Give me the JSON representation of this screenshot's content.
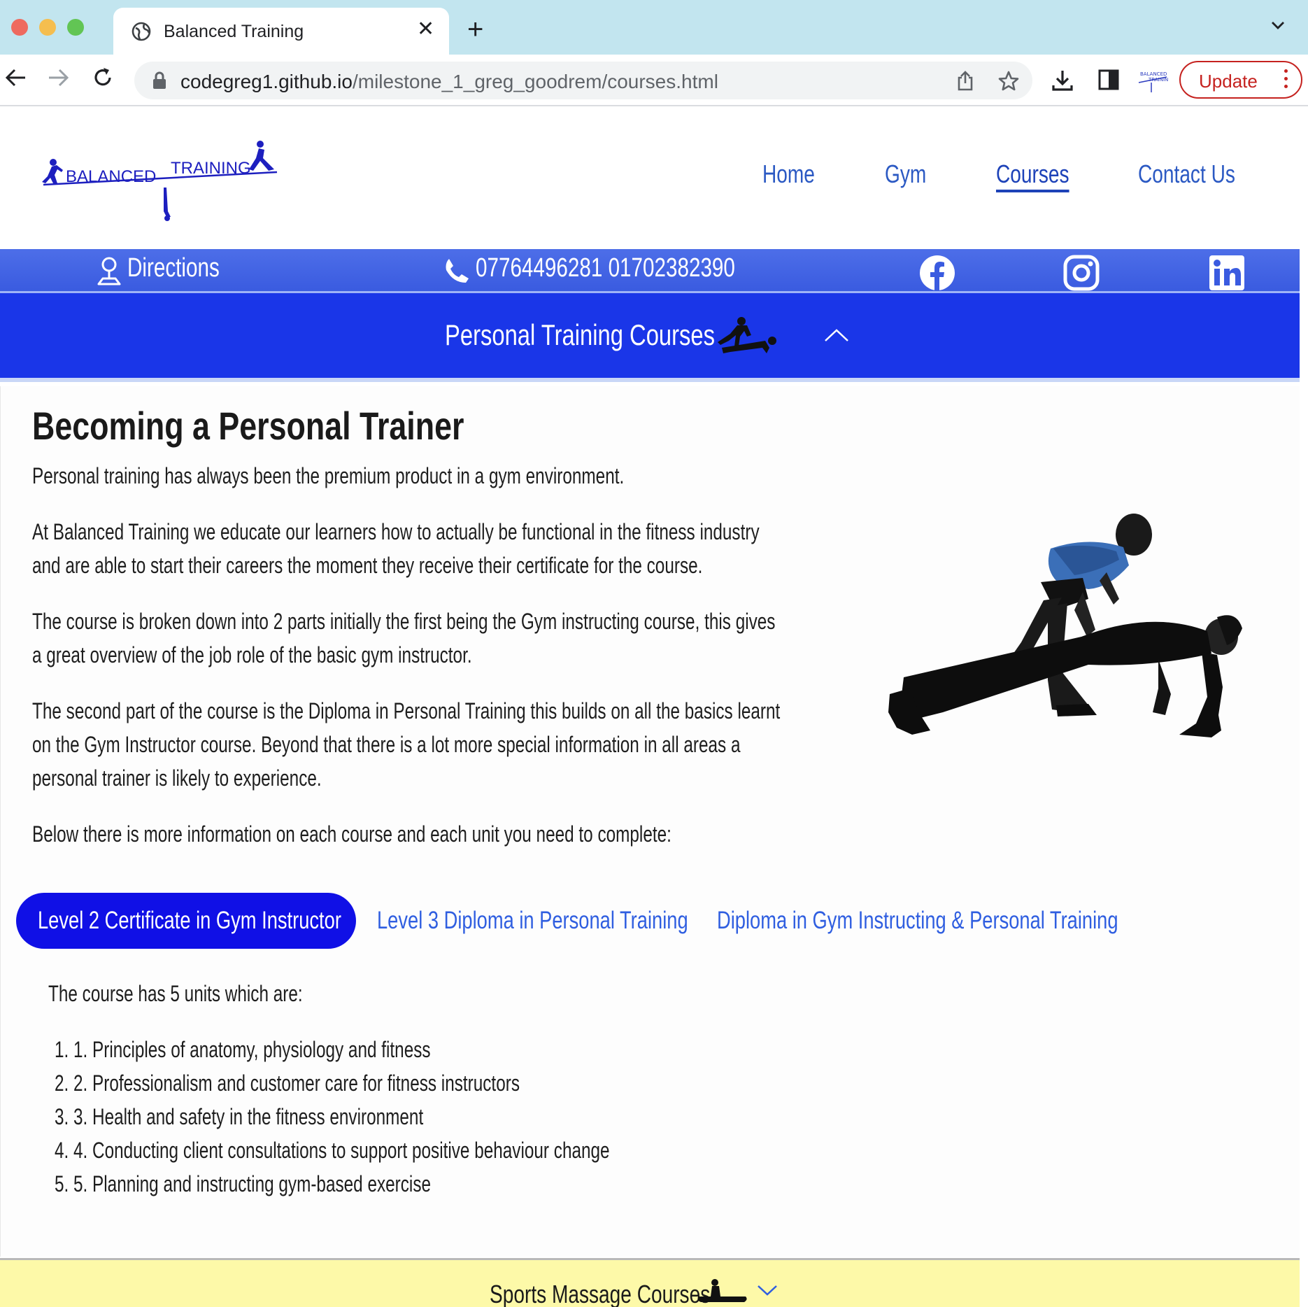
{
  "browser": {
    "tab_title": "Balanced Training",
    "url_host": "codegreg1.github.io",
    "url_path": "/milestone_1_greg_goodrem/courses.html",
    "update_label": "Update",
    "colors": {
      "tabbar": "#c2e5ef",
      "update": "#c5221f"
    }
  },
  "site": {
    "logo_text_left": "BALANCED",
    "logo_text_right": "TRAINING",
    "nav": [
      {
        "label": "Home"
      },
      {
        "label": "Gym"
      },
      {
        "label": "Courses",
        "active": true
      },
      {
        "label": "Contact Us"
      }
    ],
    "info": {
      "directions": "Directions",
      "phones": "07764496281 01702382390",
      "social_icons": [
        "facebook-icon",
        "instagram-icon",
        "linkedin-icon"
      ]
    },
    "colors": {
      "accent": "#1a36e8",
      "link": "#2b59c3",
      "infobar": "#3a5be0",
      "massage": "#fdf9a8"
    }
  },
  "section": {
    "title": "Personal Training Courses",
    "heading": "Becoming a Personal Trainer",
    "paragraphs": [
      [
        "Personal training has always been the premium product in a gym environment."
      ],
      [
        "At Balanced Training we educate our learners how to actually be functional in the fitness industry",
        "and are able to start their careers the moment they receive their certificate for the course."
      ],
      [
        "The course is broken down into 2 parts initially the first being the Gym instructing course, this gives",
        "a great overview of the job role of the basic gym instructor."
      ],
      [
        "The second part of the course is the Diploma in Personal Training this builds on all the basics learnt",
        "on the Gym Instructor course. Beyond that there is a lot more special information in all areas a",
        "personal trainer is likely to experience."
      ],
      [
        "Below there is more information on each course and each unit you need to complete:"
      ]
    ],
    "course_tabs": [
      {
        "label": "Level 2 Certificate in Gym Instructor",
        "active": true
      },
      {
        "label": "Level 3 Diploma in Personal Training"
      },
      {
        "label": "Diploma in Gym Instructing & Personal Training"
      }
    ],
    "units_intro": "The course has 5 units which are:",
    "units": [
      "1. Principles of anatomy, physiology and fitness",
      "2. Professionalism and customer care for fitness instructors",
      "3. Health and safety in the fitness environment",
      "4. Conducting client consultations to support positive behaviour change",
      "5. Planning and instructing gym-based exercise"
    ]
  },
  "next_section": {
    "title": "Sports Massage Courses"
  }
}
